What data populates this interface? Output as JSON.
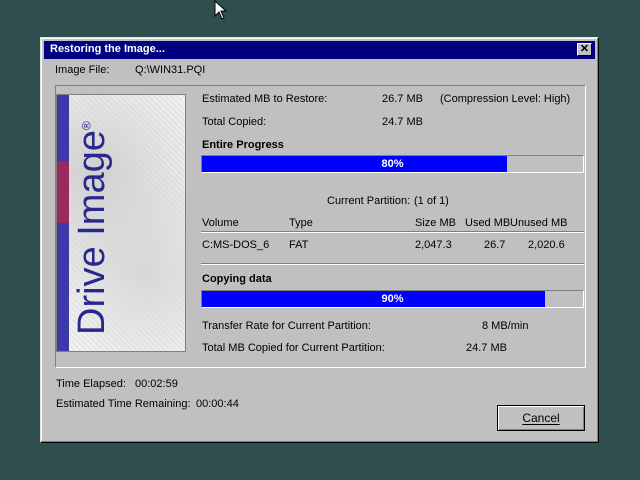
{
  "window": {
    "title": "Restoring the Image...",
    "close_symbol": "✕"
  },
  "image_file": {
    "label": "Image File:",
    "value": "Q:\\WIN31.PQI"
  },
  "logo": {
    "brand": "Drive Image",
    "mark": "®"
  },
  "summary": {
    "estimated_label": "Estimated MB to Restore:",
    "estimated_value": "26.7  MB",
    "compression": "(Compression Level: High)",
    "total_copied_label": "Total Copied:",
    "total_copied_value": "24.7  MB"
  },
  "entire_progress": {
    "heading": "Entire Progress",
    "percent": 80,
    "label": "80%"
  },
  "partition": {
    "current_label": "Current Partition:",
    "current_value": "(1 of 1)",
    "columns": {
      "volume": "Volume",
      "type": "Type",
      "size": "Size MB",
      "used": "Used MB",
      "unused": "Unused MB"
    },
    "row": {
      "volume": "C:MS-DOS_6",
      "type": "FAT",
      "size": "2,047.3",
      "used": "26.7",
      "unused": "2,020.6"
    }
  },
  "copying_progress": {
    "heading": "Copying data",
    "percent": 90,
    "label": "90%"
  },
  "transfer": {
    "rate_label": "Transfer Rate for Current Partition:",
    "rate_value": "8  MB/min",
    "total_label": "Total MB Copied for Current Partition:",
    "total_value": "24.7  MB"
  },
  "time": {
    "elapsed_label": "Time Elapsed:",
    "elapsed_value": "00:02:59",
    "remaining_label": "Estimated Time Remaining:",
    "remaining_value": "00:00:44"
  },
  "buttons": {
    "cancel": "Cancel"
  },
  "colors": {
    "titlebar": "#000080",
    "progress_fill": "#0000ff",
    "face": "#c0c0c0",
    "desktop": "#2f4f4f"
  }
}
